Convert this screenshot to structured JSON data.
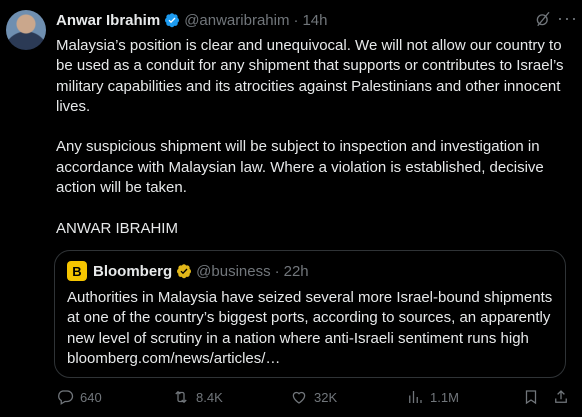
{
  "author": {
    "name": "Anwar Ibrahim",
    "handle": "@anwaribrahim",
    "separator": "·",
    "time": "14h"
  },
  "tweet": {
    "text": "Malaysia’s position is clear and unequivocal. We will not allow our country to be used as a conduit for any shipment that supports or contributes to Israel’s military capabilities and its atrocities against Palestinians and other innocent lives.\n\nAny suspicious shipment will be subject to inspection and investigation in accordance with Malaysian law. Where a violation is established, decisive action will be taken.\n\nANWAR IBRAHIM"
  },
  "quote": {
    "logo": "B",
    "name": "Bloomberg",
    "handle": "@business",
    "separator": "·",
    "time": "22h",
    "text": "Authorities in Malaysia have seized several more Israel-bound shipments at one of the country’s biggest ports, according to sources, an apparently new level of scrutiny in a nation where anti-Israeli sentiment runs high bloomberg.com/news/articles/…"
  },
  "actions": {
    "replies": "640",
    "reposts": "8.4K",
    "likes": "32K",
    "views": "1.1M"
  },
  "colors": {
    "verified_blue": "#1d9bf0",
    "verified_gold": "#e2b719",
    "bloomberg_logo": "#f5c400"
  },
  "icons": [
    "grok-icon",
    "more-icon",
    "reply-icon",
    "repost-icon",
    "like-icon",
    "views-icon",
    "bookmark-icon",
    "share-icon"
  ]
}
